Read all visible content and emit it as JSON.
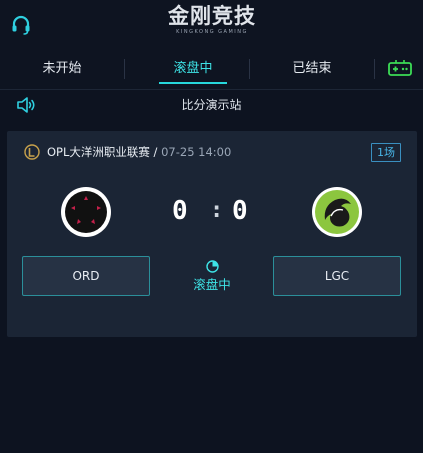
{
  "header": {
    "logo_cn": "金刚竞技",
    "logo_en": "KINGKONG GAMING"
  },
  "tabs": [
    {
      "label": "未开始",
      "active": false
    },
    {
      "label": "滚盘中",
      "active": true
    },
    {
      "label": "已结束",
      "active": false
    }
  ],
  "notice": {
    "text": "比分演示站"
  },
  "match": {
    "league": "OPL大洋洲职业联赛",
    "separator": " / ",
    "datetime": "07-25 14:00",
    "games_badge": "1场",
    "home": {
      "name": "ORD",
      "score": "0"
    },
    "away": {
      "name": "LGC",
      "score": "0"
    },
    "score_separator": ":",
    "status": "滚盘中"
  },
  "colors": {
    "accent": "#3ee3e6",
    "background": "#0d1320",
    "card": "#1b2535",
    "badge": "#48b6e8",
    "gamepad": "#3cdc56"
  }
}
